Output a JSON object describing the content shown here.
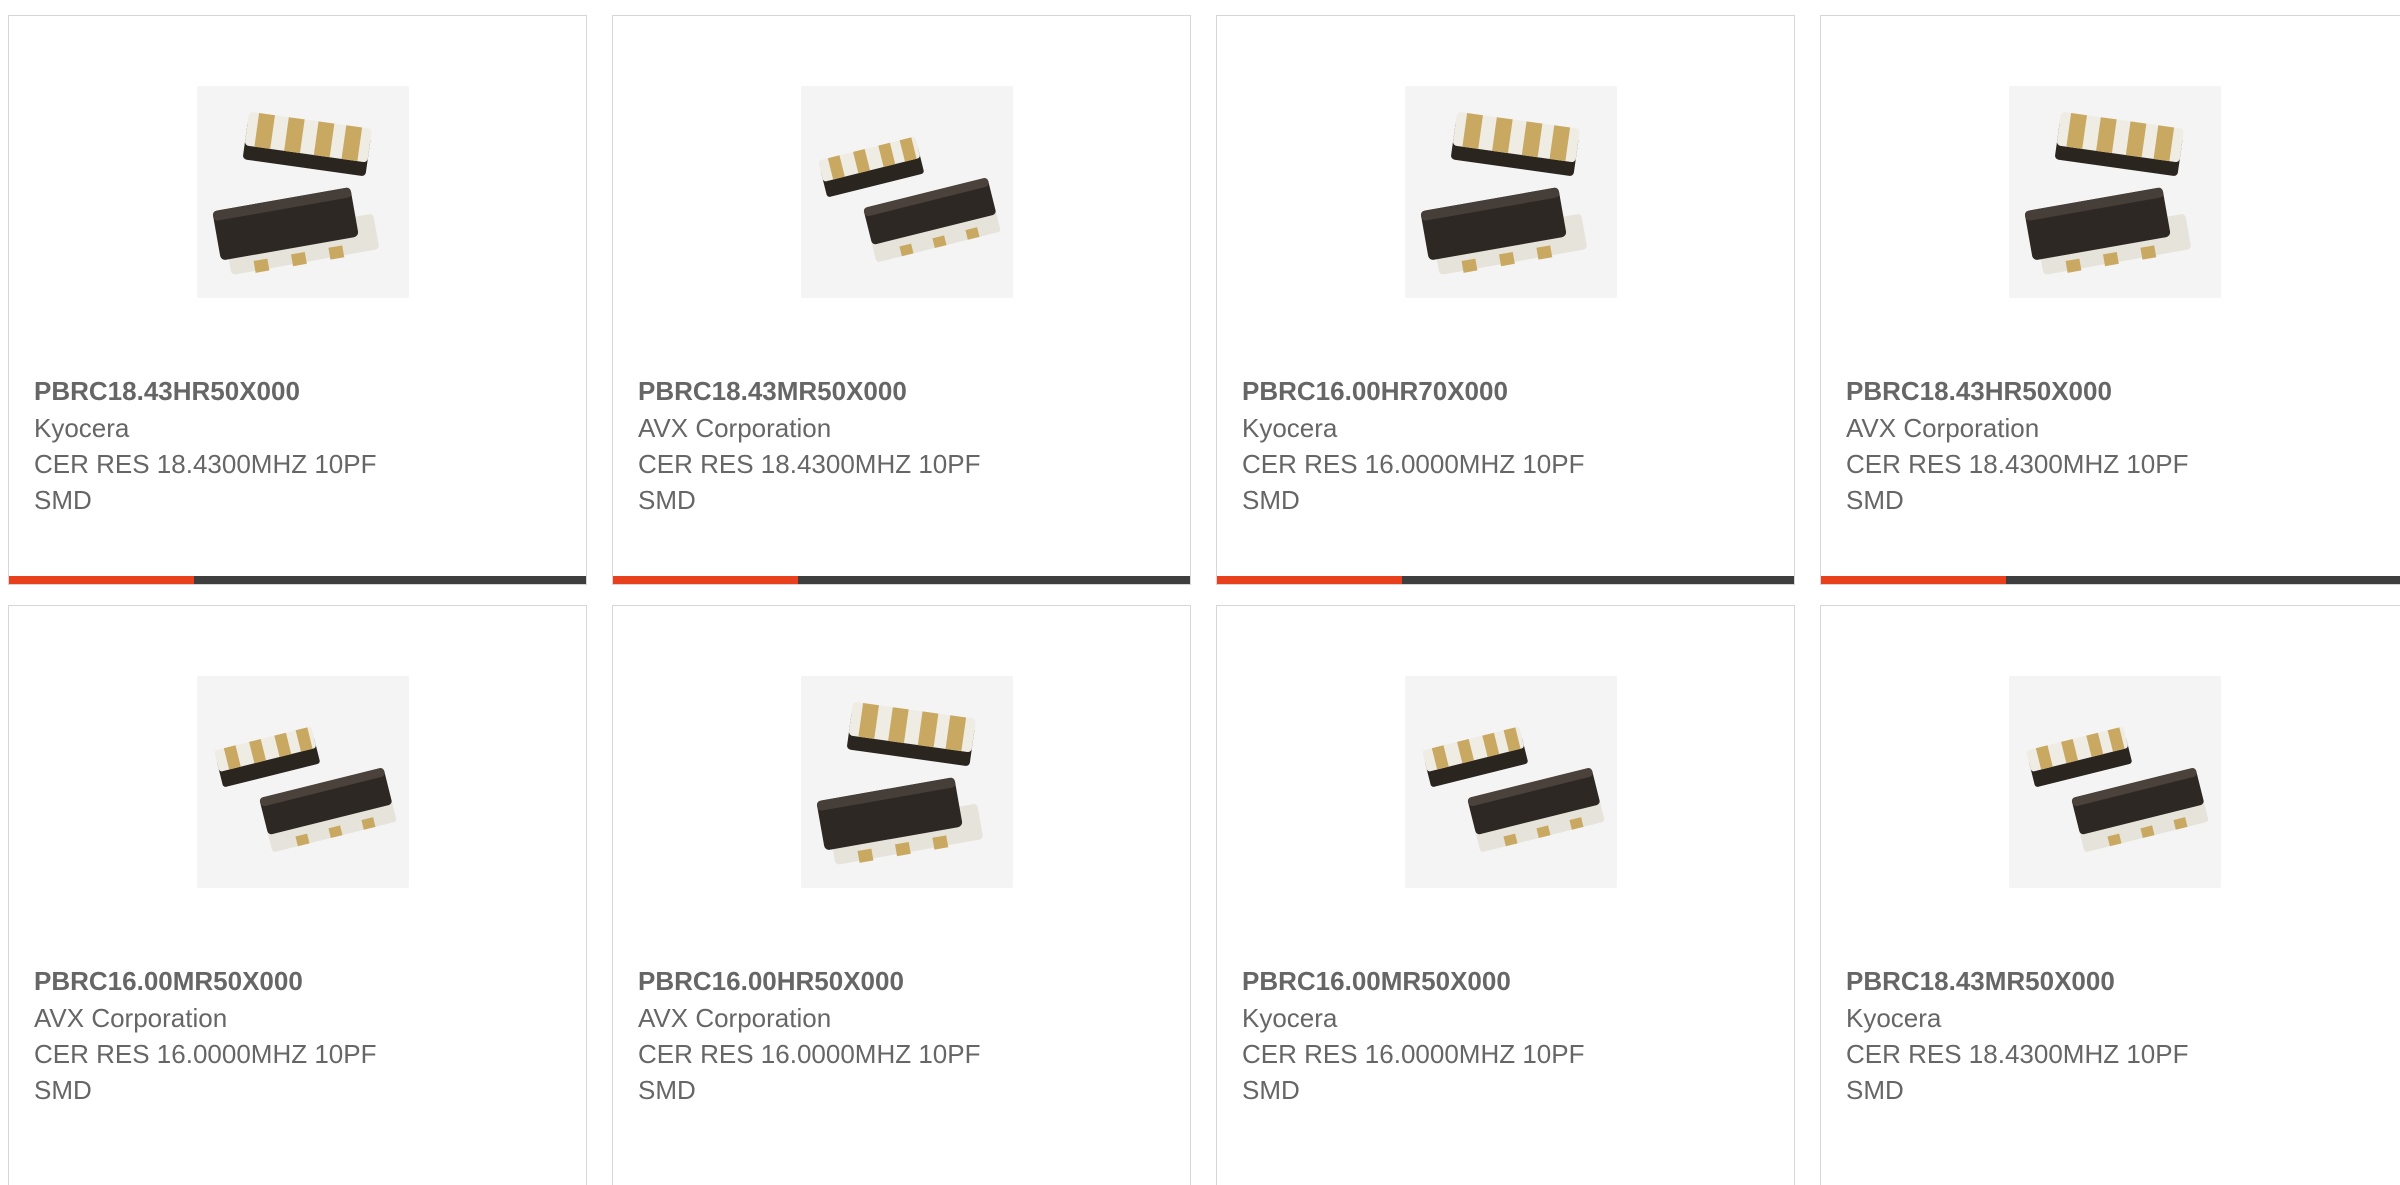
{
  "accent_color": "#e8401c",
  "bar_track_color": "#3e3e3e",
  "products": [
    {
      "part": "PBRC18.43HR50X000",
      "manufacturer": "Kyocera",
      "desc_line1": "CER RES 18.4300MHZ 10PF",
      "desc_line2": "SMD",
      "image_variant": "stacked",
      "image_icon": "ceramic-resonator-image"
    },
    {
      "part": "PBRC18.43MR50X000",
      "manufacturer": "AVX Corporation",
      "desc_line1": "CER RES 18.4300MHZ 10PF",
      "desc_line2": "SMD",
      "image_variant": "side-by-side",
      "image_icon": "ceramic-resonator-image"
    },
    {
      "part": "PBRC16.00HR70X000",
      "manufacturer": "Kyocera",
      "desc_line1": "CER RES 16.0000MHZ 10PF",
      "desc_line2": "SMD",
      "image_variant": "stacked",
      "image_icon": "ceramic-resonator-image"
    },
    {
      "part": "PBRC18.43HR50X000",
      "manufacturer": "AVX Corporation",
      "desc_line1": "CER RES 18.4300MHZ 10PF",
      "desc_line2": "SMD",
      "image_variant": "stacked",
      "image_icon": "ceramic-resonator-image"
    },
    {
      "part": "PBRC16.00MR50X000",
      "manufacturer": "AVX Corporation",
      "desc_line1": "CER RES 16.0000MHZ 10PF",
      "desc_line2": "SMD",
      "image_variant": "side-by-side",
      "image_icon": "ceramic-resonator-image"
    },
    {
      "part": "PBRC16.00HR50X000",
      "manufacturer": "AVX Corporation",
      "desc_line1": "CER RES 16.0000MHZ 10PF",
      "desc_line2": "SMD",
      "image_variant": "stacked",
      "image_icon": "ceramic-resonator-image"
    },
    {
      "part": "PBRC16.00MR50X000",
      "manufacturer": "Kyocera",
      "desc_line1": "CER RES 16.0000MHZ 10PF",
      "desc_line2": "SMD",
      "image_variant": "side-by-side",
      "image_icon": "ceramic-resonator-image"
    },
    {
      "part": "PBRC18.43MR50X000",
      "manufacturer": "Kyocera",
      "desc_line1": "CER RES 18.4300MHZ 10PF",
      "desc_line2": "SMD",
      "image_variant": "side-by-side",
      "image_icon": "ceramic-resonator-image"
    }
  ],
  "first_row_progress_fraction": 0.32
}
